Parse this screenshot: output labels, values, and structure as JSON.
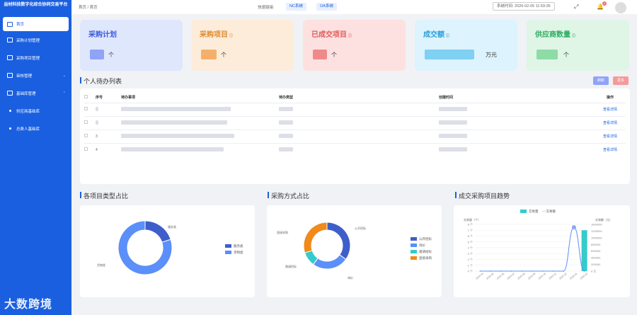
{
  "sidebar": {
    "brand": "益材科技数字化综合协同交易平台",
    "items": [
      {
        "label": "首页",
        "active": true
      },
      {
        "label": "采购计划管理"
      },
      {
        "label": "采购项目管理"
      },
      {
        "label": "审核管理"
      },
      {
        "label": "基础库管理"
      },
      {
        "label": "供应商基础库"
      },
      {
        "label": "总费人基础库"
      }
    ],
    "watermark": "大数跨境"
  },
  "topbar": {
    "breadcrumb": "首页 / 首页",
    "quick_label": "快速链接:",
    "quick_links": [
      "NC系统",
      "OA系统"
    ],
    "time_label": "系统时间: 2026-02-05 11:59:35",
    "bell_badge": "4"
  },
  "cards": [
    {
      "title": "采购计划",
      "unit": "个",
      "bg": "#dfe7fd",
      "blur": "#8fa3f7"
    },
    {
      "title": "采购项目",
      "unit": "个",
      "bg": "#fdecd9",
      "blur": "#f4b06a"
    },
    {
      "title": "已成交项目",
      "unit": "个",
      "bg": "#fde0e0",
      "blur": "#f08a8a"
    },
    {
      "title": "成交额",
      "unit": "万元",
      "bg": "#ddf3fd",
      "blur": "#7fd0f2"
    },
    {
      "title": "供应商数量",
      "unit": "个",
      "bg": "#dff5e6",
      "blur": "#8edba6"
    }
  ],
  "todo": {
    "title": "个人待办列表",
    "buttons": [
      "刷新",
      "更多"
    ],
    "columns": [
      "序号",
      "待办事项",
      "待办类型",
      "创建时间",
      "操作"
    ],
    "rows": [
      {
        "no": "",
        "action": "查看详情"
      },
      {
        "no": "",
        "action": "查看详情"
      },
      {
        "no": "3",
        "action": "查看详情"
      },
      {
        "no": "4",
        "action": "查看详情"
      }
    ]
  },
  "panels": {
    "type_ratio": {
      "title": "各项目类型占比",
      "chart_data": {
        "type": "pie",
        "categories": [
          "服务类",
          "货物类"
        ],
        "values": [
          20,
          80
        ],
        "colors": [
          "#3e5fc9",
          "#5b8ff9"
        ]
      }
    },
    "method_ratio": {
      "title": "采购方式占比",
      "chart_data": {
        "type": "pie",
        "categories": [
          "公开招标",
          "询价",
          "邀请招标",
          "直接采购"
        ],
        "values": [
          35,
          25,
          10,
          30
        ],
        "colors": [
          "#3e5fc9",
          "#5b8ff9",
          "#36cbcb",
          "#f08a1a"
        ]
      }
    },
    "trend": {
      "title": "成交采购项目趋势",
      "chart_data": {
        "type": "bar",
        "legend": [
          "交易量",
          "交易额"
        ],
        "y_left_label": "交易量（个）",
        "y_right_label": "交易额（元）",
        "y_left_ticks": [
          "8 个",
          "7 个",
          "6 个",
          "5 个",
          "4 个",
          "3 个",
          "2 个",
          "1 个",
          "0 个"
        ],
        "y_right_ticks": [
          "1600000",
          "1200000",
          "1000000",
          "800000",
          "600000",
          "400000",
          "200000",
          "0 元"
        ],
        "categories": [
          "2025-04",
          "2025-05",
          "2025-06",
          "2025-07",
          "2025-08",
          "2025-09",
          "2025-10",
          "2025-11",
          "2025-12",
          "2026-01",
          "2026-02"
        ],
        "series": [
          {
            "name": "交易量",
            "values": [
              0,
              0,
              0,
              0,
              0,
              0,
              0,
              0,
              0,
              0,
              7
            ]
          },
          {
            "name": "交易额",
            "values": [
              0,
              0,
              0,
              0,
              0,
              0,
              0,
              0,
              0,
              1500000,
              0
            ]
          }
        ]
      }
    }
  }
}
